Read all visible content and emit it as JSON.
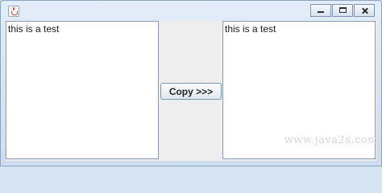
{
  "window": {
    "icon": "java-cup-icon",
    "controls": [
      "minimize-icon",
      "maximize-icon",
      "close-icon"
    ]
  },
  "left_text": "this is a test",
  "right_text": "this is a test",
  "copy_button_label": "Copy >>>",
  "watermark": "www.java2s.com"
}
